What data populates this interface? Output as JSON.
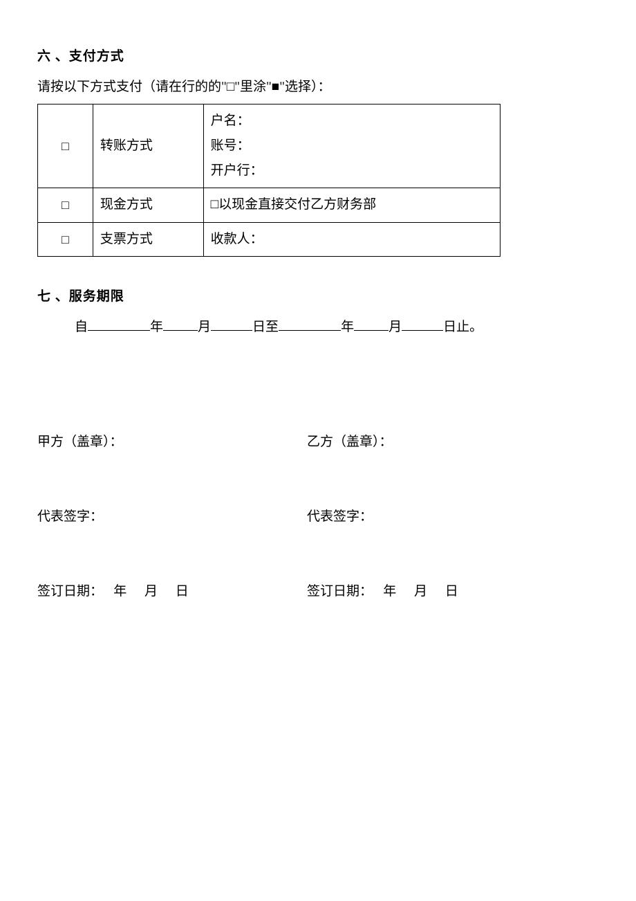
{
  "section6": {
    "title": "六 、支付方式",
    "instruction": "请按以下方式支付（请在行的的\"□\"里涂\"■\"选择）：",
    "checkbox": "□",
    "rows": [
      {
        "method": "转账方式",
        "detail_line1": "户名：",
        "detail_line2": "账号：",
        "detail_line3": "开户行："
      },
      {
        "method": "现金方式",
        "detail": "□以现金直接交付乙方财务部"
      },
      {
        "method": "支票方式",
        "detail": "收款人："
      }
    ]
  },
  "section7": {
    "title": "七 、服务期限",
    "date": {
      "prefix": "自",
      "year": "年",
      "month": "月",
      "day_to": "日至",
      "year2": "年",
      "month2": "月",
      "day_end": "日止。"
    }
  },
  "signature": {
    "party_a_seal": "甲方（盖章）：",
    "party_b_seal": "乙方（盖章）：",
    "rep_sign_a": "代表签字：",
    "rep_sign_b": "代表签字：",
    "sign_date_a_label": "签订日期：",
    "sign_date_b_label": "签订日期：",
    "year": "年",
    "month": "月",
    "day": "日"
  }
}
